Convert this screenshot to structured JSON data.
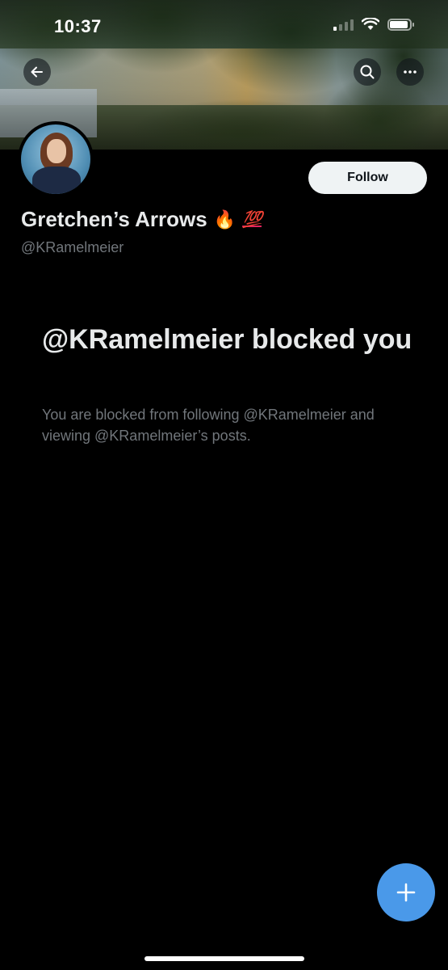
{
  "status_bar": {
    "time": "10:37",
    "battery_level": 0.85
  },
  "header": {
    "back_icon": "arrow-left-icon",
    "search_icon": "search-icon",
    "more_icon": "more-horizontal-icon"
  },
  "profile": {
    "display_name": "Gretchen’s Arrows",
    "name_emojis": [
      "🔥",
      "💯"
    ],
    "handle": "@KRamelmeier",
    "follow_label": "Follow"
  },
  "blocked": {
    "title": "@KRamelmeier blocked you",
    "description": "You are blocked from following @KRamelmeier and viewing @KRamelmeier’s posts."
  },
  "fab": {
    "icon": "plus-icon"
  },
  "colors": {
    "background": "#000000",
    "primary_text": "#e7e9ea",
    "secondary_text": "#71767b",
    "accent": "#4a99e9",
    "follow_button_bg": "#eff3f4"
  }
}
